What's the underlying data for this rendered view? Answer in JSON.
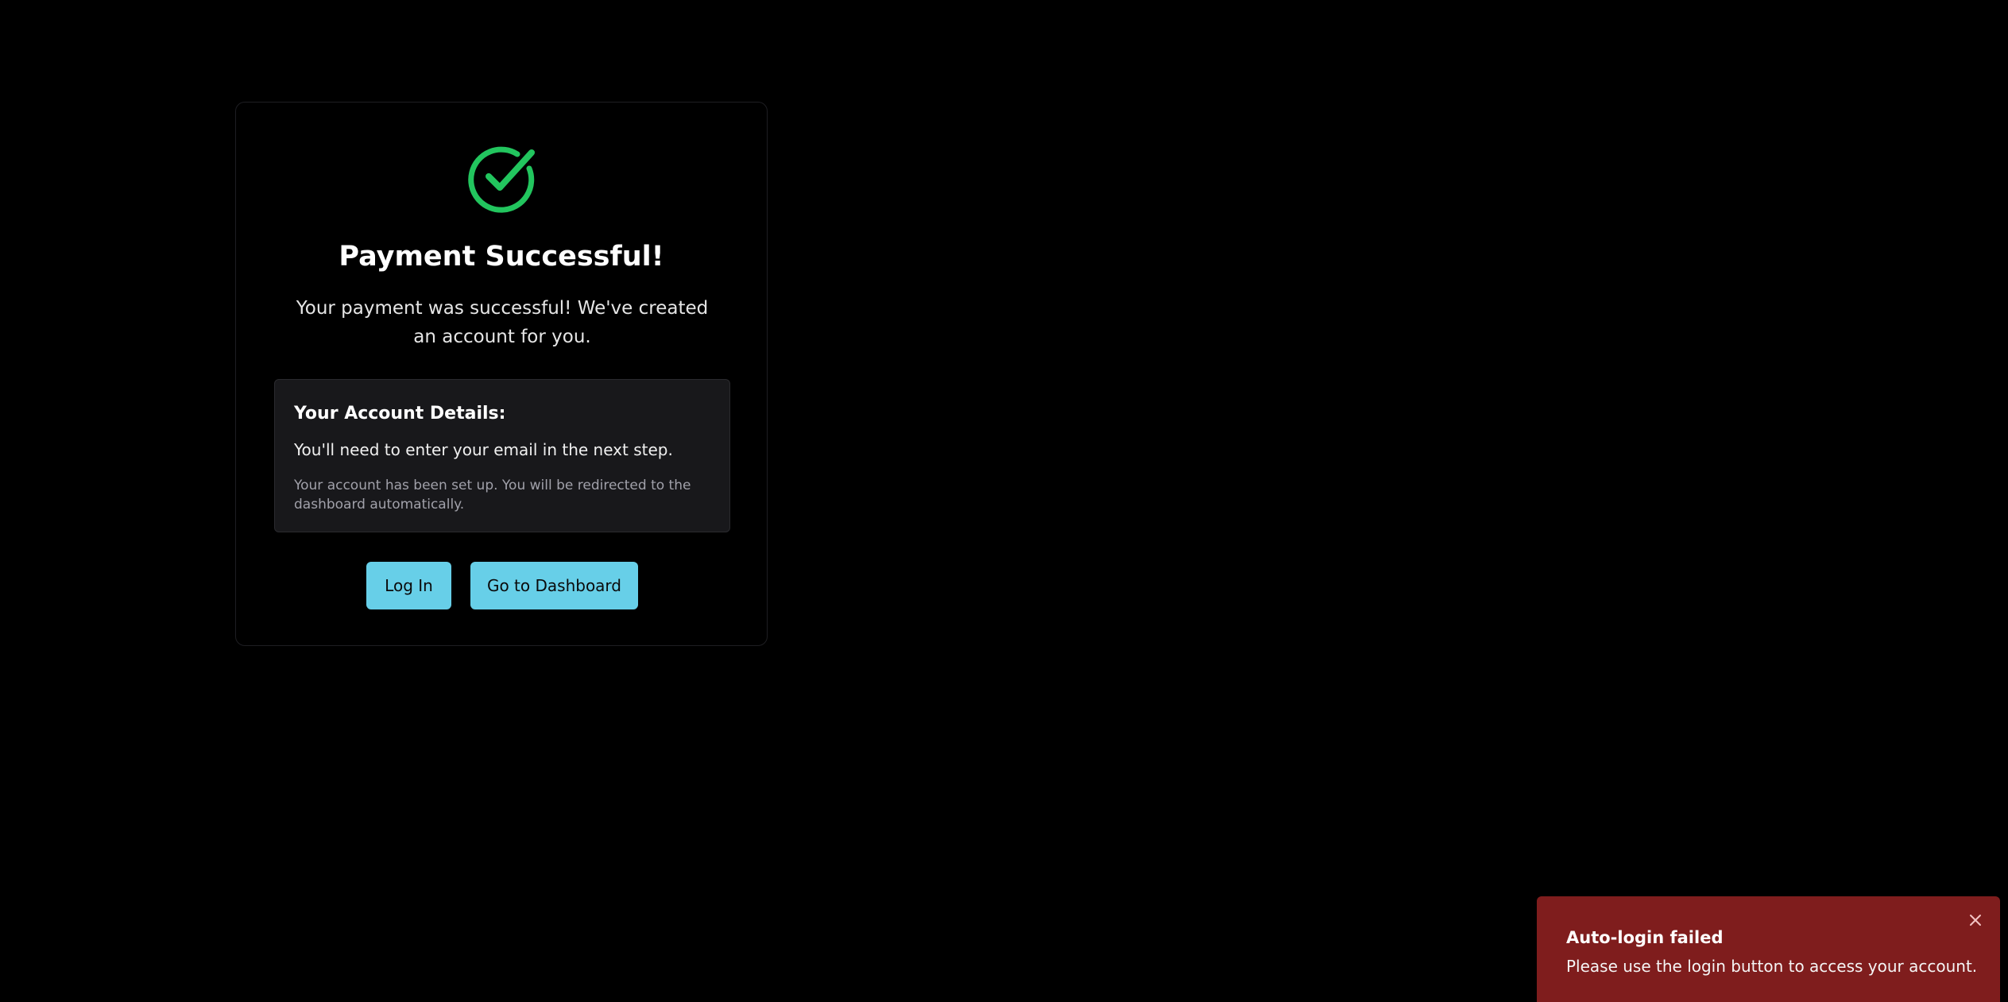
{
  "card": {
    "title": "Payment Successful!",
    "message": "Your payment was successful! We've created an account for you.",
    "details": {
      "heading": "Your Account Details:",
      "line": "You'll need to enter your email in the next step.",
      "note": "Your account has been set up. You will be redirected to the dashboard automatically."
    },
    "buttons": {
      "login_label": "Log In",
      "dashboard_label": "Go to Dashboard"
    }
  },
  "toast": {
    "title": "Auto-login failed",
    "message": "Please use the login button to access your account."
  },
  "icons": {
    "success": "check-circle-icon",
    "close": "close-icon"
  },
  "colors": {
    "success": "#22c55e",
    "button": "#67cfe8",
    "toast_bg": "#7f1d1d"
  }
}
